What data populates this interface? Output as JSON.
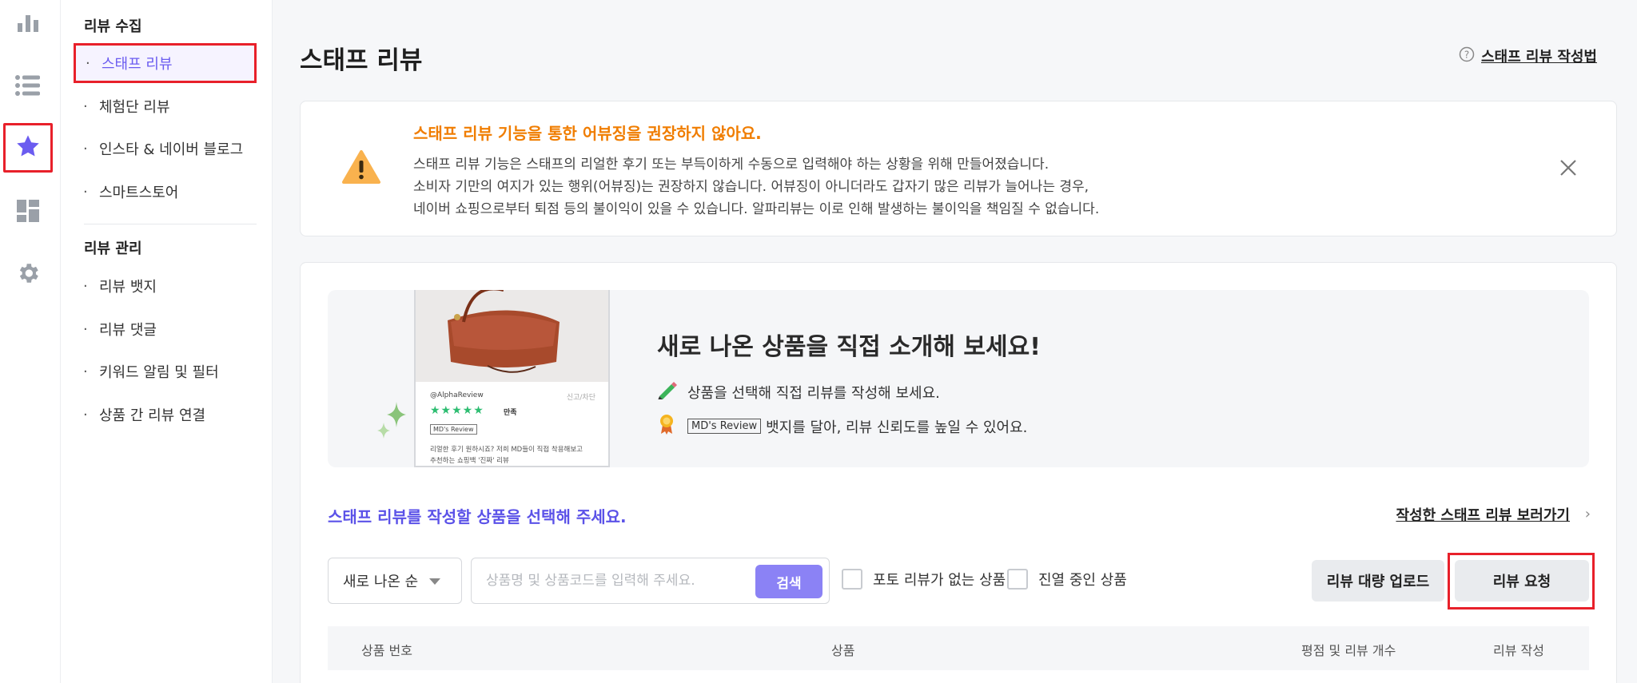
{
  "rail": {
    "items": [
      {
        "icon": "bar-chart-icon"
      },
      {
        "icon": "list-icon"
      },
      {
        "icon": "star-icon",
        "active": true
      },
      {
        "icon": "dashboard-icon"
      },
      {
        "icon": "gear-icon"
      }
    ]
  },
  "menu": {
    "section1_title": "리뷰 수집",
    "section1_items": [
      "스태프 리뷰",
      "체험단 리뷰",
      "인스타 & 네이버 블로그",
      "스마트스토어"
    ],
    "section2_title": "리뷰 관리",
    "section2_items": [
      "리뷰 뱃지",
      "리뷰 댓글",
      "키워드 알림 및 필터",
      "상품 간 리뷰 연결"
    ],
    "bullet": "·"
  },
  "header": {
    "title": "스태프 리뷰",
    "help_link": "스태프 리뷰 작성법"
  },
  "notice": {
    "title": "스태프 리뷰 기능을 통한 어뷰징을 권장하지 않아요.",
    "lines": [
      "스태프 리뷰 기능은 스태프의 리얼한 후기 또는 부득이하게 수동으로 입력해야 하는 상황을 위해 만들어졌습니다.",
      "소비자 기만의 여지가 있는 행위(어뷰징)는 권장하지 않습니다. 어뷰징이 아니더라도 갑자기 많은 리뷰가 늘어나는 경우,",
      "네이버 쇼핑으로부터 퇴점 등의 불이익이 있을 수 있습니다. 알파리뷰는 이로 인해 발생하는 불이익을 책임질 수 없습니다."
    ]
  },
  "promo": {
    "title": "새로 나온 상품을 직접 소개해 보세요!",
    "line1": "상품을 선택해 직접 리뷰를 작성해 보세요.",
    "line2_badge": "MD's Review",
    "line2": "뱃지를 달아, 리뷰 신뢰도를 높일 수 있어요.",
    "phone": {
      "user": "@AlphaReview",
      "report": "신고/차단",
      "stars": "★★★★★",
      "rating_text": "만족",
      "badge": "MD's Review",
      "text_line1": "리얼한 후기 원하시죠? 저희 MD들이 직접 착용해보고",
      "text_line2": "추천하는 쇼핑백 '진짜' 리뷰"
    }
  },
  "products": {
    "prompt": "스태프 리뷰를 작성할 상품을 선택해 주세요.",
    "written_link": "작성한 스태프 리뷰 보러가기",
    "sort_value": "새로 나온 순",
    "search_placeholder": "상품명 및 상품코드를 입력해 주세요.",
    "search_button": "검색",
    "filter1": "포토 리뷰가 없는 상품",
    "filter2": "진열 중인 상품",
    "bulk_upload": "리뷰 대량 업로드",
    "request": "리뷰 요청",
    "columns": [
      "상품 번호",
      "상품",
      "평점 및 리뷰 개수",
      "리뷰 작성"
    ]
  },
  "colors": {
    "accent": "#6b5cf0",
    "warning": "#f07d00",
    "highlight": "#e8202a"
  }
}
